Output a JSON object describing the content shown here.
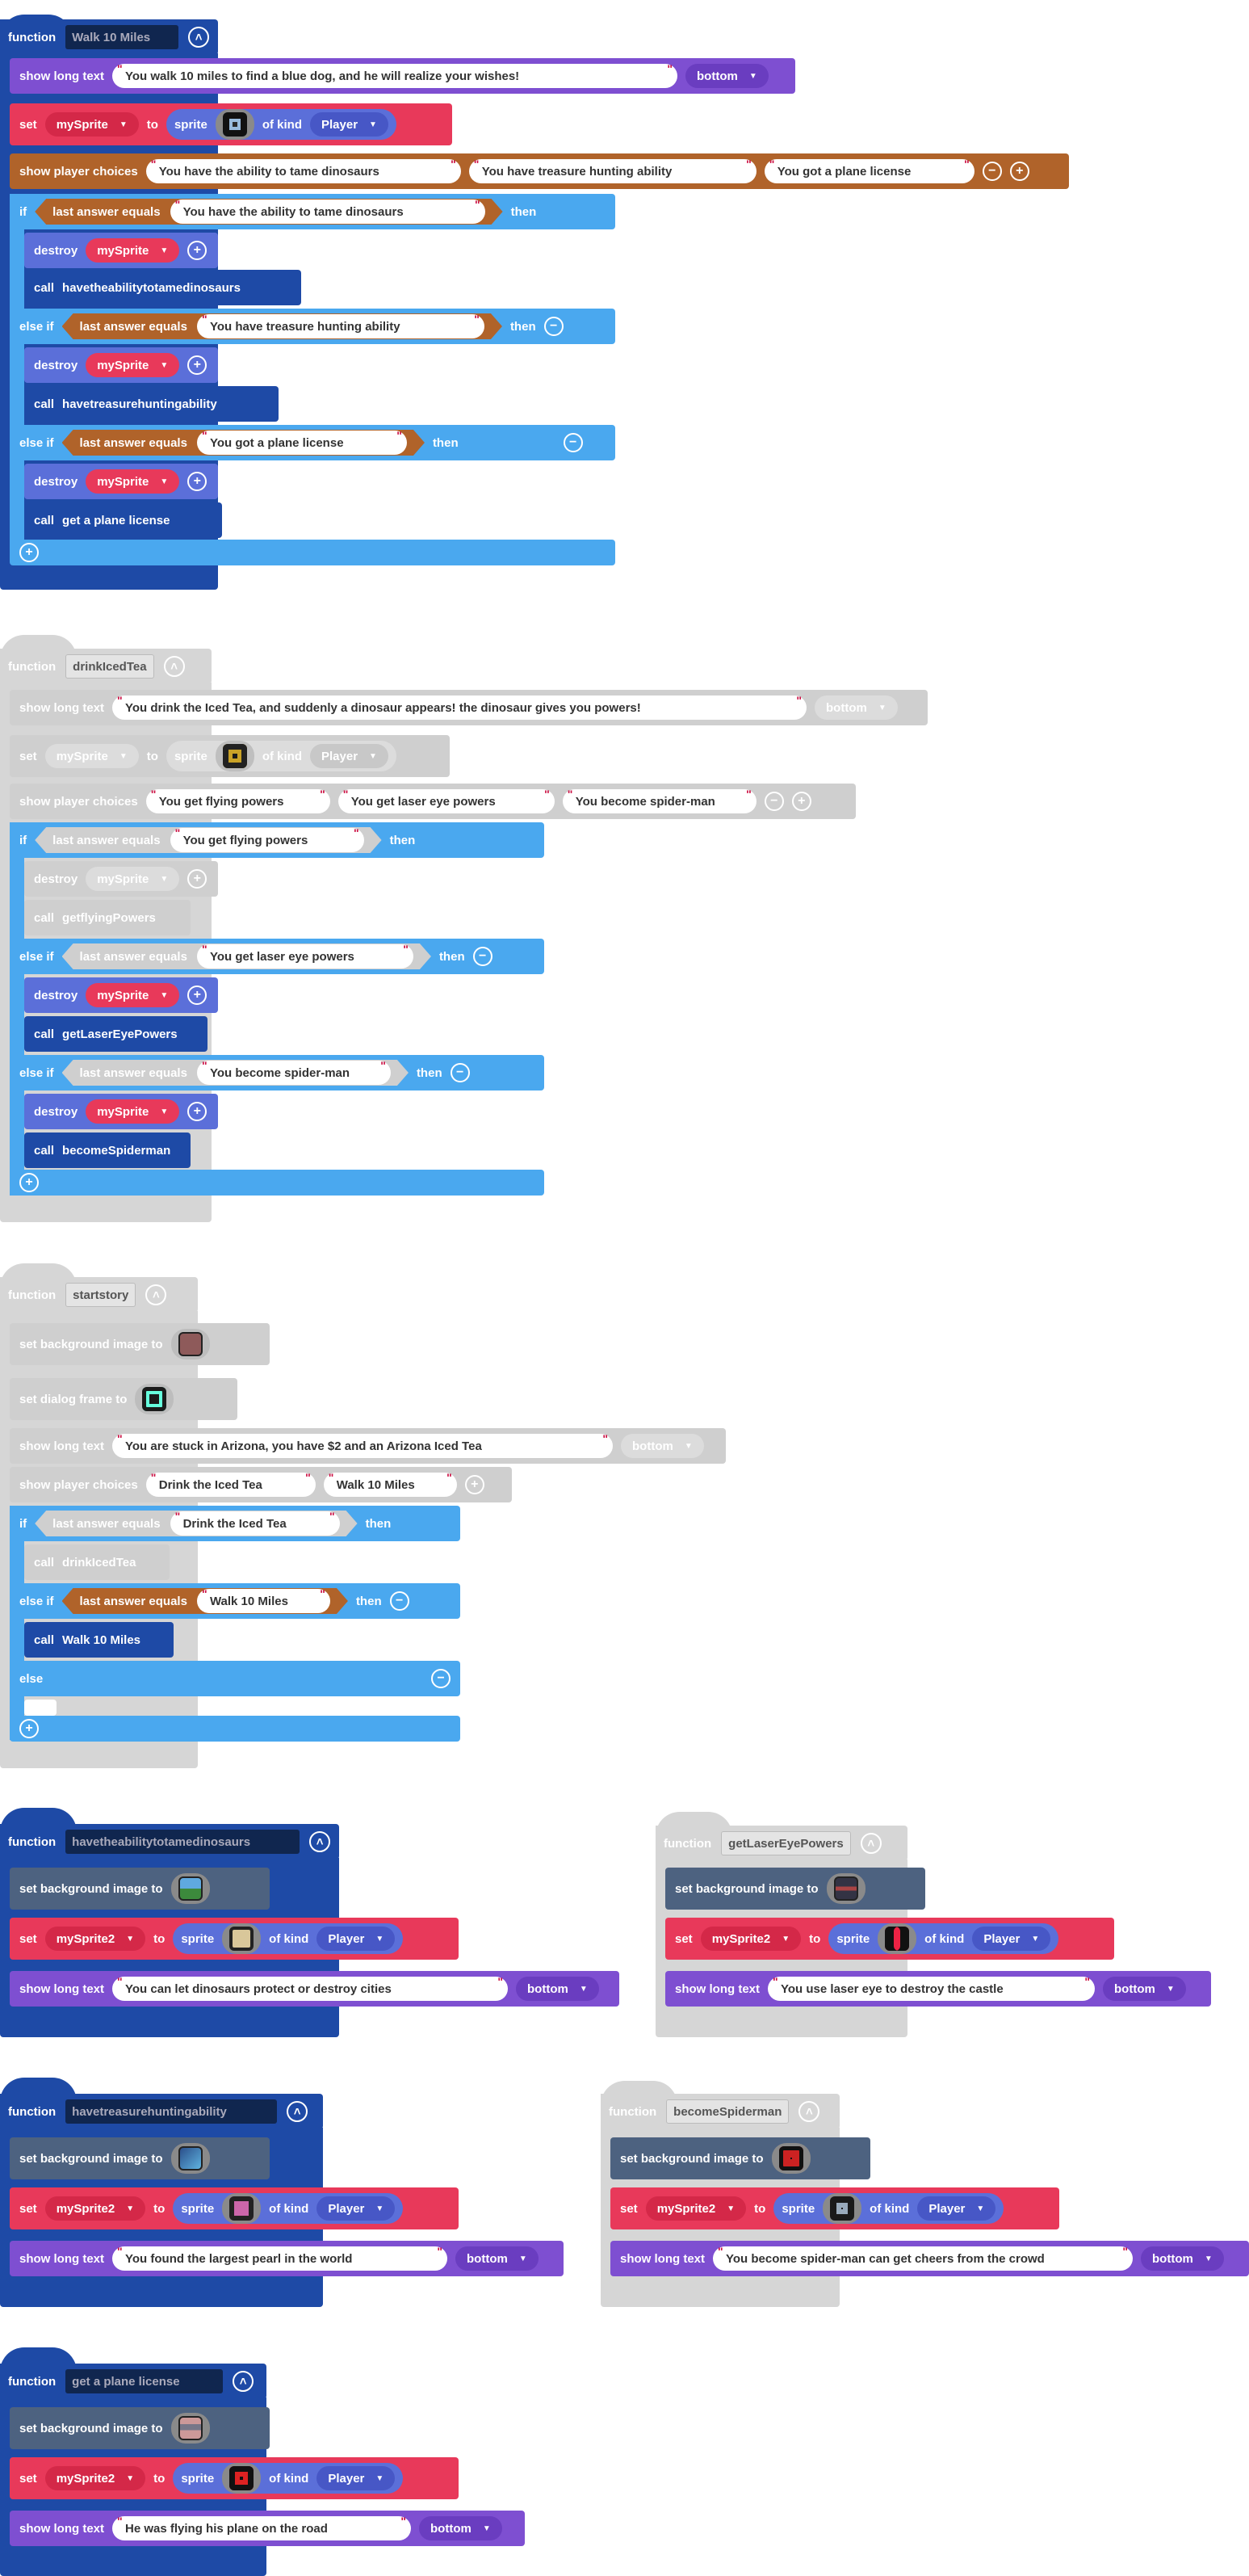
{
  "labels": {
    "function": "function",
    "show_long_text": "show long text",
    "set": "set",
    "to": "to",
    "sprite": "sprite",
    "of_kind": "of kind",
    "show_player_choices": "show player choices",
    "if": "if",
    "else_if": "else if",
    "else": "else",
    "last_answer_equals": "last answer equals",
    "then": "then",
    "destroy": "destroy",
    "call": "call",
    "set_background": "set background image to",
    "set_dialog_frame": "set dialog frame to"
  },
  "common": {
    "bottom": "bottom",
    "player": "Player",
    "mySprite": "mySprite",
    "mySprite2": "mySprite2"
  },
  "walk10": {
    "name": "Walk 10 Miles",
    "text": "You walk 10 miles to find a blue dog, and he will realize your wishes!",
    "choices": [
      "You have the ability to tame dinosaurs",
      "You have treasure hunting ability",
      "You got a plane license"
    ],
    "calls": [
      "havetheabilitytotamedinosaurs",
      "havetreasurehuntingability",
      "get a plane license"
    ]
  },
  "drink": {
    "name": "drinkIcedTea",
    "text": "You drink the Iced Tea, and suddenly a dinosaur appears! the dinosaur gives you powers!",
    "choices": [
      "You get flying powers",
      "You get laser eye powers",
      "You become spider-man"
    ],
    "calls": [
      "getflyingPowers",
      "getLaserEyePowers",
      "becomeSpiderman"
    ]
  },
  "start": {
    "name": "startstory",
    "text": "You are stuck in Arizona, you have $2 and an Arizona Iced Tea",
    "choices": [
      "Drink the Iced Tea",
      "Walk 10 Miles"
    ],
    "calls": [
      "drinkIcedTea",
      "Walk 10 Miles"
    ]
  },
  "tame": {
    "name": "havetheabilitytotamedinosaurs",
    "text": "You can let dinosaurs protect or destroy cities"
  },
  "laser": {
    "name": "getLaserEyePowers",
    "text": "You use laser eye to destroy the castle"
  },
  "treasure": {
    "name": "havetreasurehuntingability",
    "text": "You found the largest pearl in the world"
  },
  "spider": {
    "name": "becomeSpiderman",
    "text": "You become spider-man can get cheers from the crowd"
  },
  "plane": {
    "name": "get a plane license",
    "text": "He was flying his plane on the road"
  },
  "colors": {
    "functionBlue": "#1e4aa6",
    "textPurple": "#7e4fd1",
    "spriteRed": "#e8395a",
    "choicesBrown": "#b0632a",
    "logicBlue": "#4aa8ef",
    "spritePurple": "#5b6fd9",
    "sceneGray": "#4d6280",
    "disabledGray": "#cfcfcf"
  }
}
